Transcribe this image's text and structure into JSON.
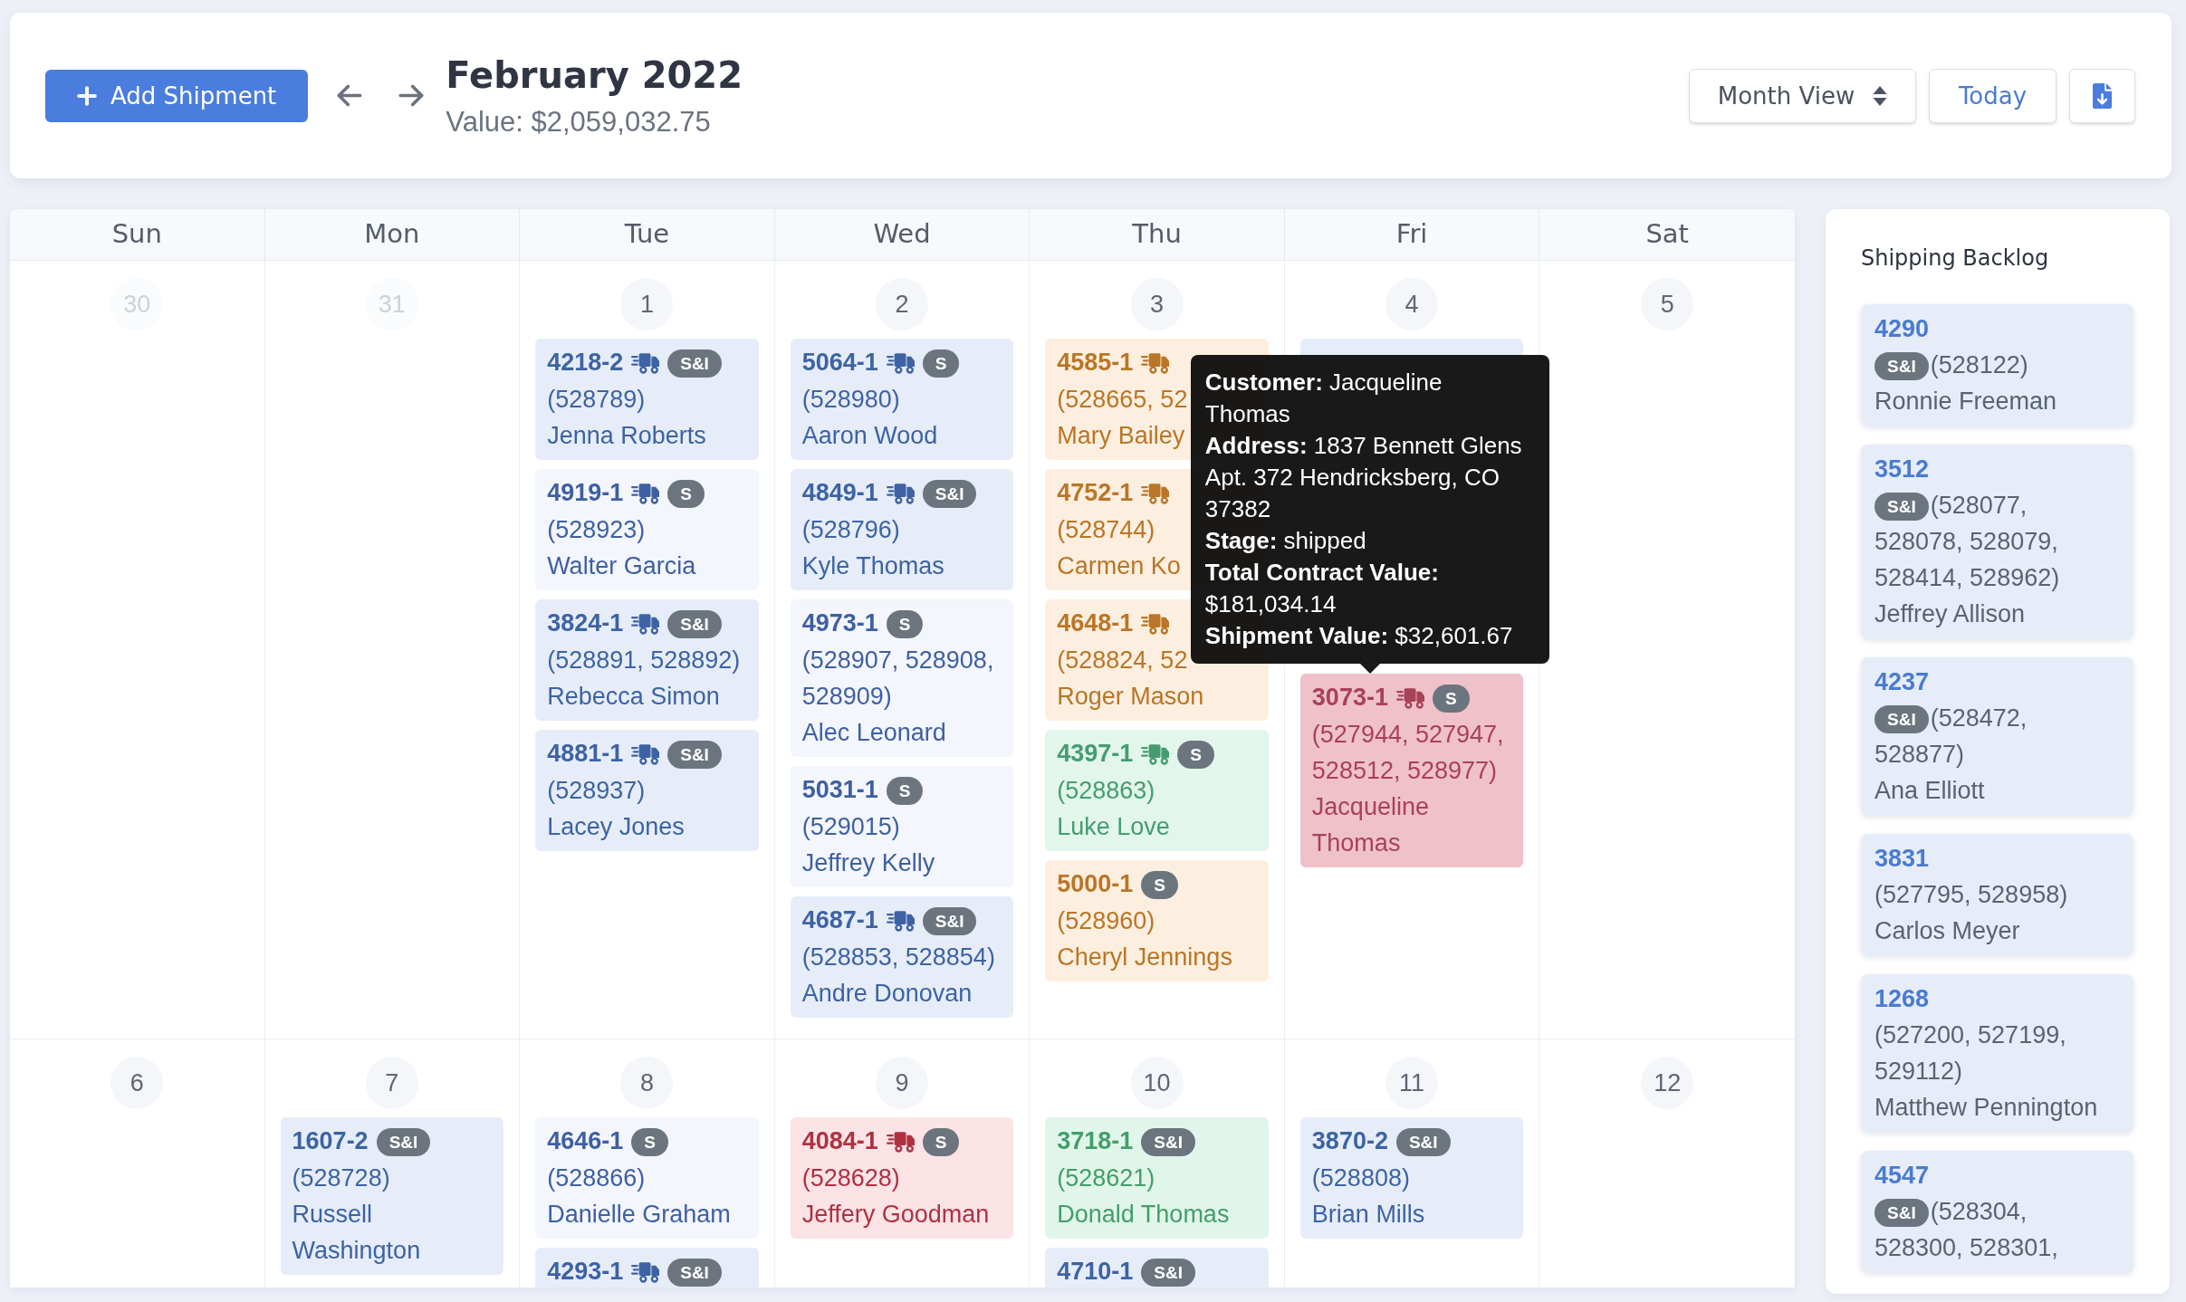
{
  "header": {
    "add_button": "Add Shipment",
    "title": "February 2022",
    "value": "Value: $2,059,032.75",
    "view_select": "Month View",
    "today_button": "Today"
  },
  "calendar": {
    "weekdays": [
      "Sun",
      "Mon",
      "Tue",
      "Wed",
      "Thu",
      "Fri",
      "Sat"
    ],
    "weeks": [
      {
        "days": [
          {
            "number": "30",
            "muted": true
          },
          {
            "number": "31",
            "muted": true
          },
          {
            "number": "1",
            "muted": false,
            "events": [
              {
                "id": "4218-2",
                "truck": true,
                "tag": "S&I",
                "orders": "(528789)",
                "customer": "Jenna Roberts",
                "color": "#e6edf9"
              },
              {
                "id": "4919-1",
                "truck": true,
                "tag": "S",
                "orders": "(528923)",
                "customer": "Walter Garcia",
                "color": "#f3f6fc"
              },
              {
                "id": "3824-1",
                "truck": true,
                "tag": "S&I",
                "orders": "(528891, 528892)",
                "customer": "Rebecca Simon",
                "color": "#e6edf9"
              },
              {
                "id": "4881-1",
                "truck": true,
                "tag": "S&I",
                "orders": "(528937)",
                "customer": "Lacey Jones",
                "color": "#e6edf9"
              }
            ]
          },
          {
            "number": "2",
            "muted": false,
            "events": [
              {
                "id": "5064-1",
                "truck": true,
                "tag": "S",
                "orders": "(528980)",
                "customer": "Aaron Wood",
                "color": "#e6edf9"
              },
              {
                "id": "4849-1",
                "truck": true,
                "tag": "S&I",
                "orders": "(528796)",
                "customer": "Kyle Thomas",
                "color": "#e6edf9"
              },
              {
                "id": "4973-1",
                "truck": false,
                "tag": "S",
                "orders": "(528907, 528908, 528909)",
                "customer": "Alec Leonard",
                "color": "#f3f6fc"
              },
              {
                "id": "5031-1",
                "truck": false,
                "tag": "S",
                "orders": "(529015)",
                "customer": "Jeffrey Kelly",
                "color": "#f3f6fc"
              },
              {
                "id": "4687-1",
                "truck": true,
                "tag": "S&I",
                "orders": "(528853, 528854)",
                "customer": "Andre Donovan",
                "color": "#e6edf9"
              }
            ]
          },
          {
            "number": "3",
            "muted": false,
            "events": [
              {
                "id": "4585-1",
                "truck": true,
                "orders": "(528665, 52",
                "customer": "Mary Bailey",
                "color": "#fdefdf"
              },
              {
                "id": "4752-1",
                "truck": true,
                "orders": "(528744)",
                "customer": "Carmen Ko",
                "color": "#fdefdf"
              },
              {
                "id": "4648-1",
                "truck": true,
                "orders": "(528824, 52",
                "customer": "Roger Mason",
                "color": "#fdefdf"
              },
              {
                "id": "4397-1",
                "truck": true,
                "tag": "S",
                "orders": "(528863)",
                "customer": "Luke Love",
                "color": "#e2f6ec"
              },
              {
                "id": "5000-1",
                "truck": false,
                "tag": "S",
                "orders": "(528960)",
                "customer": "Cheryl Jennings",
                "color": "#fdefdf"
              }
            ]
          },
          {
            "number": "4",
            "muted": false,
            "covered_events": [
              {
                "color": "#e6edf9"
              }
            ],
            "events": [
              {
                "id": "3073-1",
                "truck": true,
                "tag": "S",
                "orders": "(527944, 527947, 528512, 528977)",
                "customer": "Jacqueline Thomas",
                "color": "#efc1cb",
                "tooltip": {
                  "lines": [
                    "**Customer:** Jacqueline Thomas",
                    "**Address:** 1837 Bennett Glens Apt. 372 Hendricksberg, CO 37382",
                    "**Stage:** shipped",
                    "**Total Contract Value:** $181,034.14",
                    "**Shipment Value:** $32,601.67"
                  ]
                }
              }
            ]
          },
          {
            "number": "5",
            "muted": false
          }
        ]
      },
      {
        "days": [
          {
            "number": "6",
            "muted": false
          },
          {
            "number": "7",
            "muted": false,
            "events": [
              {
                "id": "1607-2",
                "truck": false,
                "tag": "S&I",
                "orders": "(528728)",
                "customer": "Russell Washington",
                "color": "#e6edf9"
              }
            ]
          },
          {
            "number": "8",
            "muted": false,
            "events": [
              {
                "id": "4646-1",
                "truck": false,
                "tag": "S",
                "orders": "(528866)",
                "customer": "Danielle Graham",
                "color": "#f3f6fc"
              },
              {
                "id": "4293-1",
                "truck": true,
                "tag": "S&I",
                "color": "#e6edf9"
              }
            ]
          },
          {
            "number": "9",
            "muted": false,
            "events": [
              {
                "id": "4084-1",
                "truck": true,
                "tag": "S",
                "orders": "(528628)",
                "customer": "Jeffery Goodman",
                "color": "#fbe3e6"
              }
            ]
          },
          {
            "number": "10",
            "muted": false,
            "events": [
              {
                "id": "3718-1",
                "truck": false,
                "tag": "S&I",
                "orders": "(528621)",
                "customer": "Donald Thomas",
                "color": "#e1f6ea"
              },
              {
                "id": "4710-1",
                "truck": false,
                "tag": "S&I",
                "color": "#e6edf9"
              }
            ]
          },
          {
            "number": "11",
            "muted": false,
            "events": [
              {
                "id": "3870-2",
                "truck": false,
                "tag": "S&I",
                "orders": "(528808)",
                "customer": "Brian Mills",
                "color": "#e6edf9"
              }
            ]
          },
          {
            "number": "12",
            "muted": false
          }
        ]
      }
    ]
  },
  "backlog": {
    "title": "Shipping Backlog",
    "items": [
      {
        "id": "4290",
        "tag": "S&I",
        "orders": "(528122)",
        "customer": "Ronnie Freeman"
      },
      {
        "id": "3512",
        "tag": "S&I",
        "orders": "(528077, 528078, 528079, 528414, 528962)",
        "customer": "Jeffrey Allison"
      },
      {
        "id": "4237",
        "tag": "S&I",
        "orders": "(528472, 528877)",
        "customer": "Ana Elliott"
      },
      {
        "id": "3831",
        "orders": "(527795, 528958)",
        "customer": "Carlos Meyer"
      },
      {
        "id": "1268",
        "orders": "(527200, 527199, 529112)",
        "customer": "Matthew Pennington"
      },
      {
        "id": "4547",
        "tag": "S&I",
        "orders": "(528304, 528300, 528301,"
      }
    ]
  }
}
